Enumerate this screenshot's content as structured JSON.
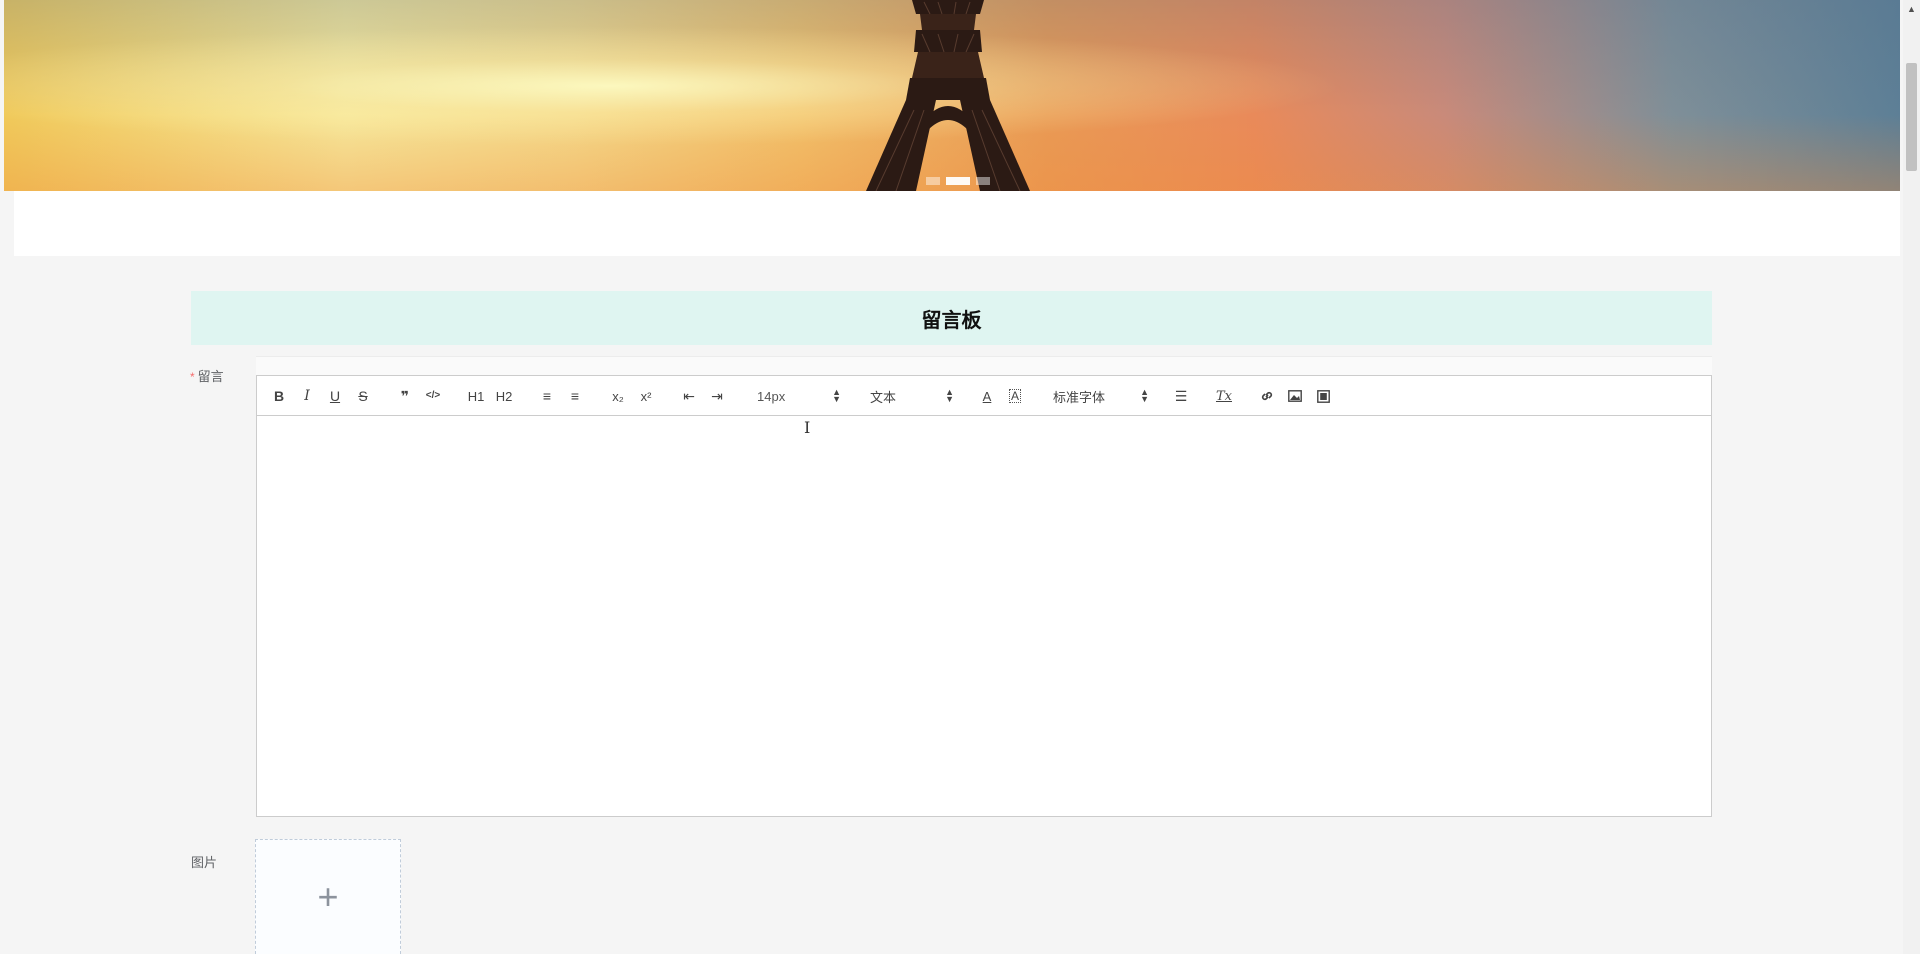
{
  "board": {
    "title": "留言板"
  },
  "form": {
    "message_label": "留言",
    "required_mark": "*",
    "image_label": "图片"
  },
  "toolbar": {
    "buttons": [
      {
        "name": "bold-button",
        "glyph": "B"
      },
      {
        "name": "italic-button",
        "glyph": "I"
      },
      {
        "name": "underline-button",
        "glyph": "U"
      },
      {
        "name": "strike-button",
        "glyph": "S"
      },
      {
        "name": "blockquote-button",
        "glyph": "❞"
      },
      {
        "name": "code-block-button",
        "glyph": "</>"
      },
      {
        "name": "header1-button",
        "glyph": "H1"
      },
      {
        "name": "header2-button",
        "glyph": "H2"
      },
      {
        "name": "ordered-list-button",
        "glyph": "≡"
      },
      {
        "name": "bullet-list-button",
        "glyph": "≡"
      },
      {
        "name": "subscript-button",
        "glyph": "x₂"
      },
      {
        "name": "superscript-button",
        "glyph": "x²"
      },
      {
        "name": "outdent-button",
        "glyph": "⇤"
      },
      {
        "name": "indent-button",
        "glyph": "⇥"
      }
    ],
    "size_picker": "14px",
    "header_picker": "文本",
    "font_picker": "标准字体",
    "end_buttons": [
      {
        "name": "text-color-icon",
        "glyph": "A"
      },
      {
        "name": "background-color-icon",
        "glyph": "A"
      },
      {
        "name": "align-icon",
        "glyph": "☰"
      },
      {
        "name": "clear-format-icon",
        "glyph": "Tx"
      },
      {
        "name": "link-icon",
        "glyph": "🔗"
      },
      {
        "name": "image-icon",
        "glyph": "▣"
      },
      {
        "name": "video-icon",
        "glyph": "▦"
      }
    ]
  },
  "upload": {
    "icon": "plus-icon",
    "glyph": "+"
  },
  "carousel": {
    "slides": 3,
    "active_index": 1
  },
  "colors": {
    "header_bg": "#dff5f1",
    "required": "#f56c6c",
    "editor_border": "#cccccc"
  }
}
